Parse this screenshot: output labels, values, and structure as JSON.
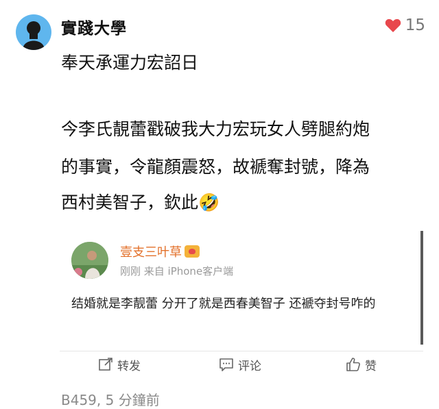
{
  "post": {
    "username": "實踐大學",
    "like_count": "15",
    "paragraph1": "奉天承運力宏詔日",
    "paragraph2_line1": "今李氏靚蕾戳破我大力宏玩女人劈腿約炮",
    "paragraph2_line2": "的事實，令龍顏震怒，故褫奪封號，降為",
    "paragraph2_line3": "西村美智子，欽此🤣"
  },
  "quoted": {
    "name": "壹支三叶草",
    "meta": "刚刚 来自 iPhone客户端",
    "text": "结婚就是李靓蕾 分开了就是西春美智子 还褫夺封号咋的"
  },
  "actions": {
    "repost": "转发",
    "comment": "评论",
    "like": "赞"
  },
  "footer": {
    "timestamp": "B459, 5 分鐘前"
  },
  "colors": {
    "like_heart": "#e8474c",
    "quoted_name": "#e3702a",
    "avatar_bg": "#5fb6ee"
  }
}
